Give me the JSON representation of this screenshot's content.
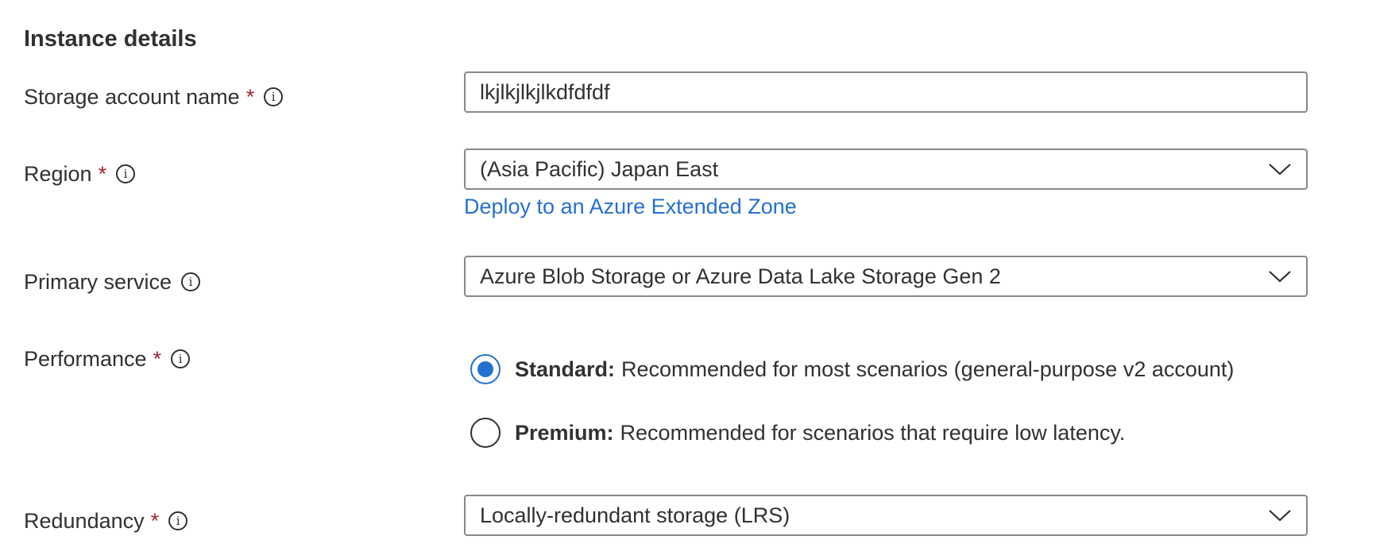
{
  "section": {
    "title": "Instance details"
  },
  "storage_account_name": {
    "label": "Storage account name",
    "required_mark": "*",
    "value": "lkjlkjlkjlkdfdfdf"
  },
  "region": {
    "label": "Region",
    "required_mark": "*",
    "selected": "(Asia Pacific) Japan East",
    "link": "Deploy to an Azure Extended Zone"
  },
  "primary_service": {
    "label": "Primary service",
    "selected": "Azure Blob Storage or Azure Data Lake Storage Gen 2"
  },
  "performance": {
    "label": "Performance",
    "required_mark": "*",
    "options": [
      {
        "name": "Standard:",
        "description": "Recommended for most scenarios (general-purpose v2 account)",
        "checked": true
      },
      {
        "name": "Premium:",
        "description": "Recommended for scenarios that require low latency.",
        "checked": false
      }
    ]
  },
  "redundancy": {
    "label": "Redundancy",
    "required_mark": "*",
    "selected": "Locally-redundant storage (LRS)"
  },
  "icons": {
    "info": "info-icon",
    "dropdown": "chevron-down-icon",
    "radio": "radio-button"
  },
  "colors": {
    "accent": "#2470d0",
    "required": "#a4262c",
    "text": "#323130",
    "border": "#8a8886"
  }
}
